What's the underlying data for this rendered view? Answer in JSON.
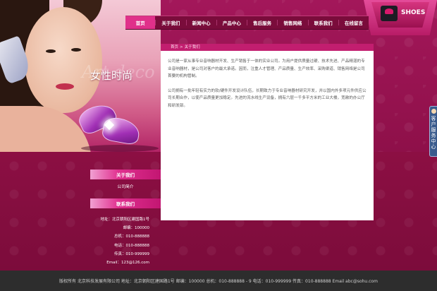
{
  "hero": {
    "title": "女性时尚",
    "script_text": "Art deco"
  },
  "logo": {
    "text": "SHOES"
  },
  "nav": {
    "items": [
      {
        "label": "首页",
        "active": true
      },
      {
        "label": "关于我们",
        "active": false
      },
      {
        "label": "新闻中心",
        "active": false
      },
      {
        "label": "产品中心",
        "active": false
      },
      {
        "label": "售后服务",
        "active": false
      },
      {
        "label": "销售网络",
        "active": false
      },
      {
        "label": "联系我们",
        "active": false
      },
      {
        "label": "在线留言",
        "active": false
      }
    ]
  },
  "breadcrumb": {
    "home": "首页",
    "separator": ">",
    "current": "关于我们"
  },
  "content": {
    "paragraph1": "公司是一家从事专业音响器材开发、生产销售于一体的实业公司。为用户提供质量过硬、技术先进、产品精湛的专业音响器材，是公司对客户的最大承诺。因而，注重人才管理、产品质量、生产效率、采购渠道、销售网络是公司首要的机构管制。",
    "paragraph2": "公司拥有一批年轻有实力的软/硬件开发设计队伍，长期致力于专业音响器材研究开发，并以国内外多项元件供应公司长期合作，以使产品质量更加稳定。先进的流水线生产设备，拥有六层一千多平方米的工业大楼，宽敞的办公厅和研发部。"
  },
  "sidebar": {
    "about_title": "关于我们",
    "about_link": "公司简介",
    "contact_title": "联系我们",
    "contact": {
      "address": "地址：北京朝阳区建国路1号",
      "postcode": "邮编：100000",
      "phone_main": "总机：010-888888",
      "phone": "电话：010-888888",
      "fax": "传真：010-999999",
      "email": "Email：123@126.com"
    }
  },
  "side_tab": {
    "label": "客户服务中心"
  },
  "footer": {
    "text": "版权所有  北京科技发展有限公司 地址：北京朝阳区建国路1号 邮编：100000   总机：010-888888 - 9 电话：010-999999 传真：010-888888 Email abc@sohu.com"
  }
}
